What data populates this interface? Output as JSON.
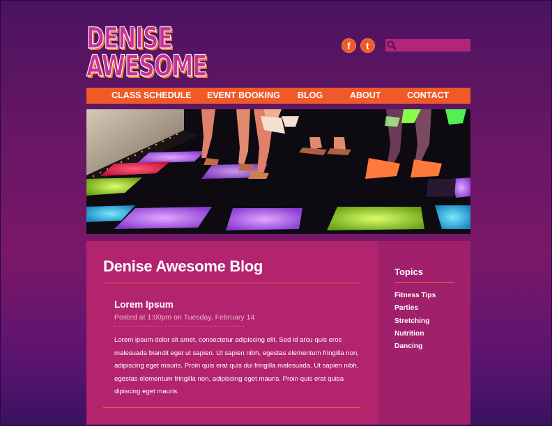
{
  "brand": {
    "logo_line1": "DENISE",
    "logo_line2": "AWESOME"
  },
  "social": [
    {
      "label": "f",
      "icon": "facebook-icon"
    },
    {
      "label": "t",
      "icon": "twitter-icon"
    }
  ],
  "search": {
    "placeholder": "",
    "icon": "search-icon"
  },
  "nav": {
    "items": [
      {
        "label": "CLASS SCHEDULE"
      },
      {
        "label": "EVENT BOOKING"
      },
      {
        "label": "BLOG"
      },
      {
        "label": "ABOUT"
      },
      {
        "label": "CONTACT"
      }
    ]
  },
  "hero": {
    "description_icon": "dance-floor-photo"
  },
  "main": {
    "title": "Denise Awesome Blog",
    "post": {
      "title": "Lorem Ipsum",
      "meta": "Posted at 1:00pm on Tuesday, February 14",
      "body": "Lorem ipsum dolor sit amet, consectetur adipiscing elit. Sed id arcu quis eros malesuada blandit eget ut sapien. Ut sapien nibh, egestas elementum fringilla non, adipiscing eget mauris. Proin quis erat quis dui fringilla malesuada. Ut sapien nibh, egestas elementum fringilla non, adipiscing eget mauris. Proin quis erat quisa dipiscing eget mauris."
    }
  },
  "sidebar": {
    "title": "Topics",
    "topics": [
      "Fitness Tips",
      "Parties",
      "Stretching",
      "Nutrition",
      "Dancing"
    ]
  },
  "colors": {
    "accent_orange": "#f05a28",
    "magenta_panel": "#b3246f",
    "sidebar_panel": "#a1206c",
    "background_purple": "#6a1666"
  }
}
